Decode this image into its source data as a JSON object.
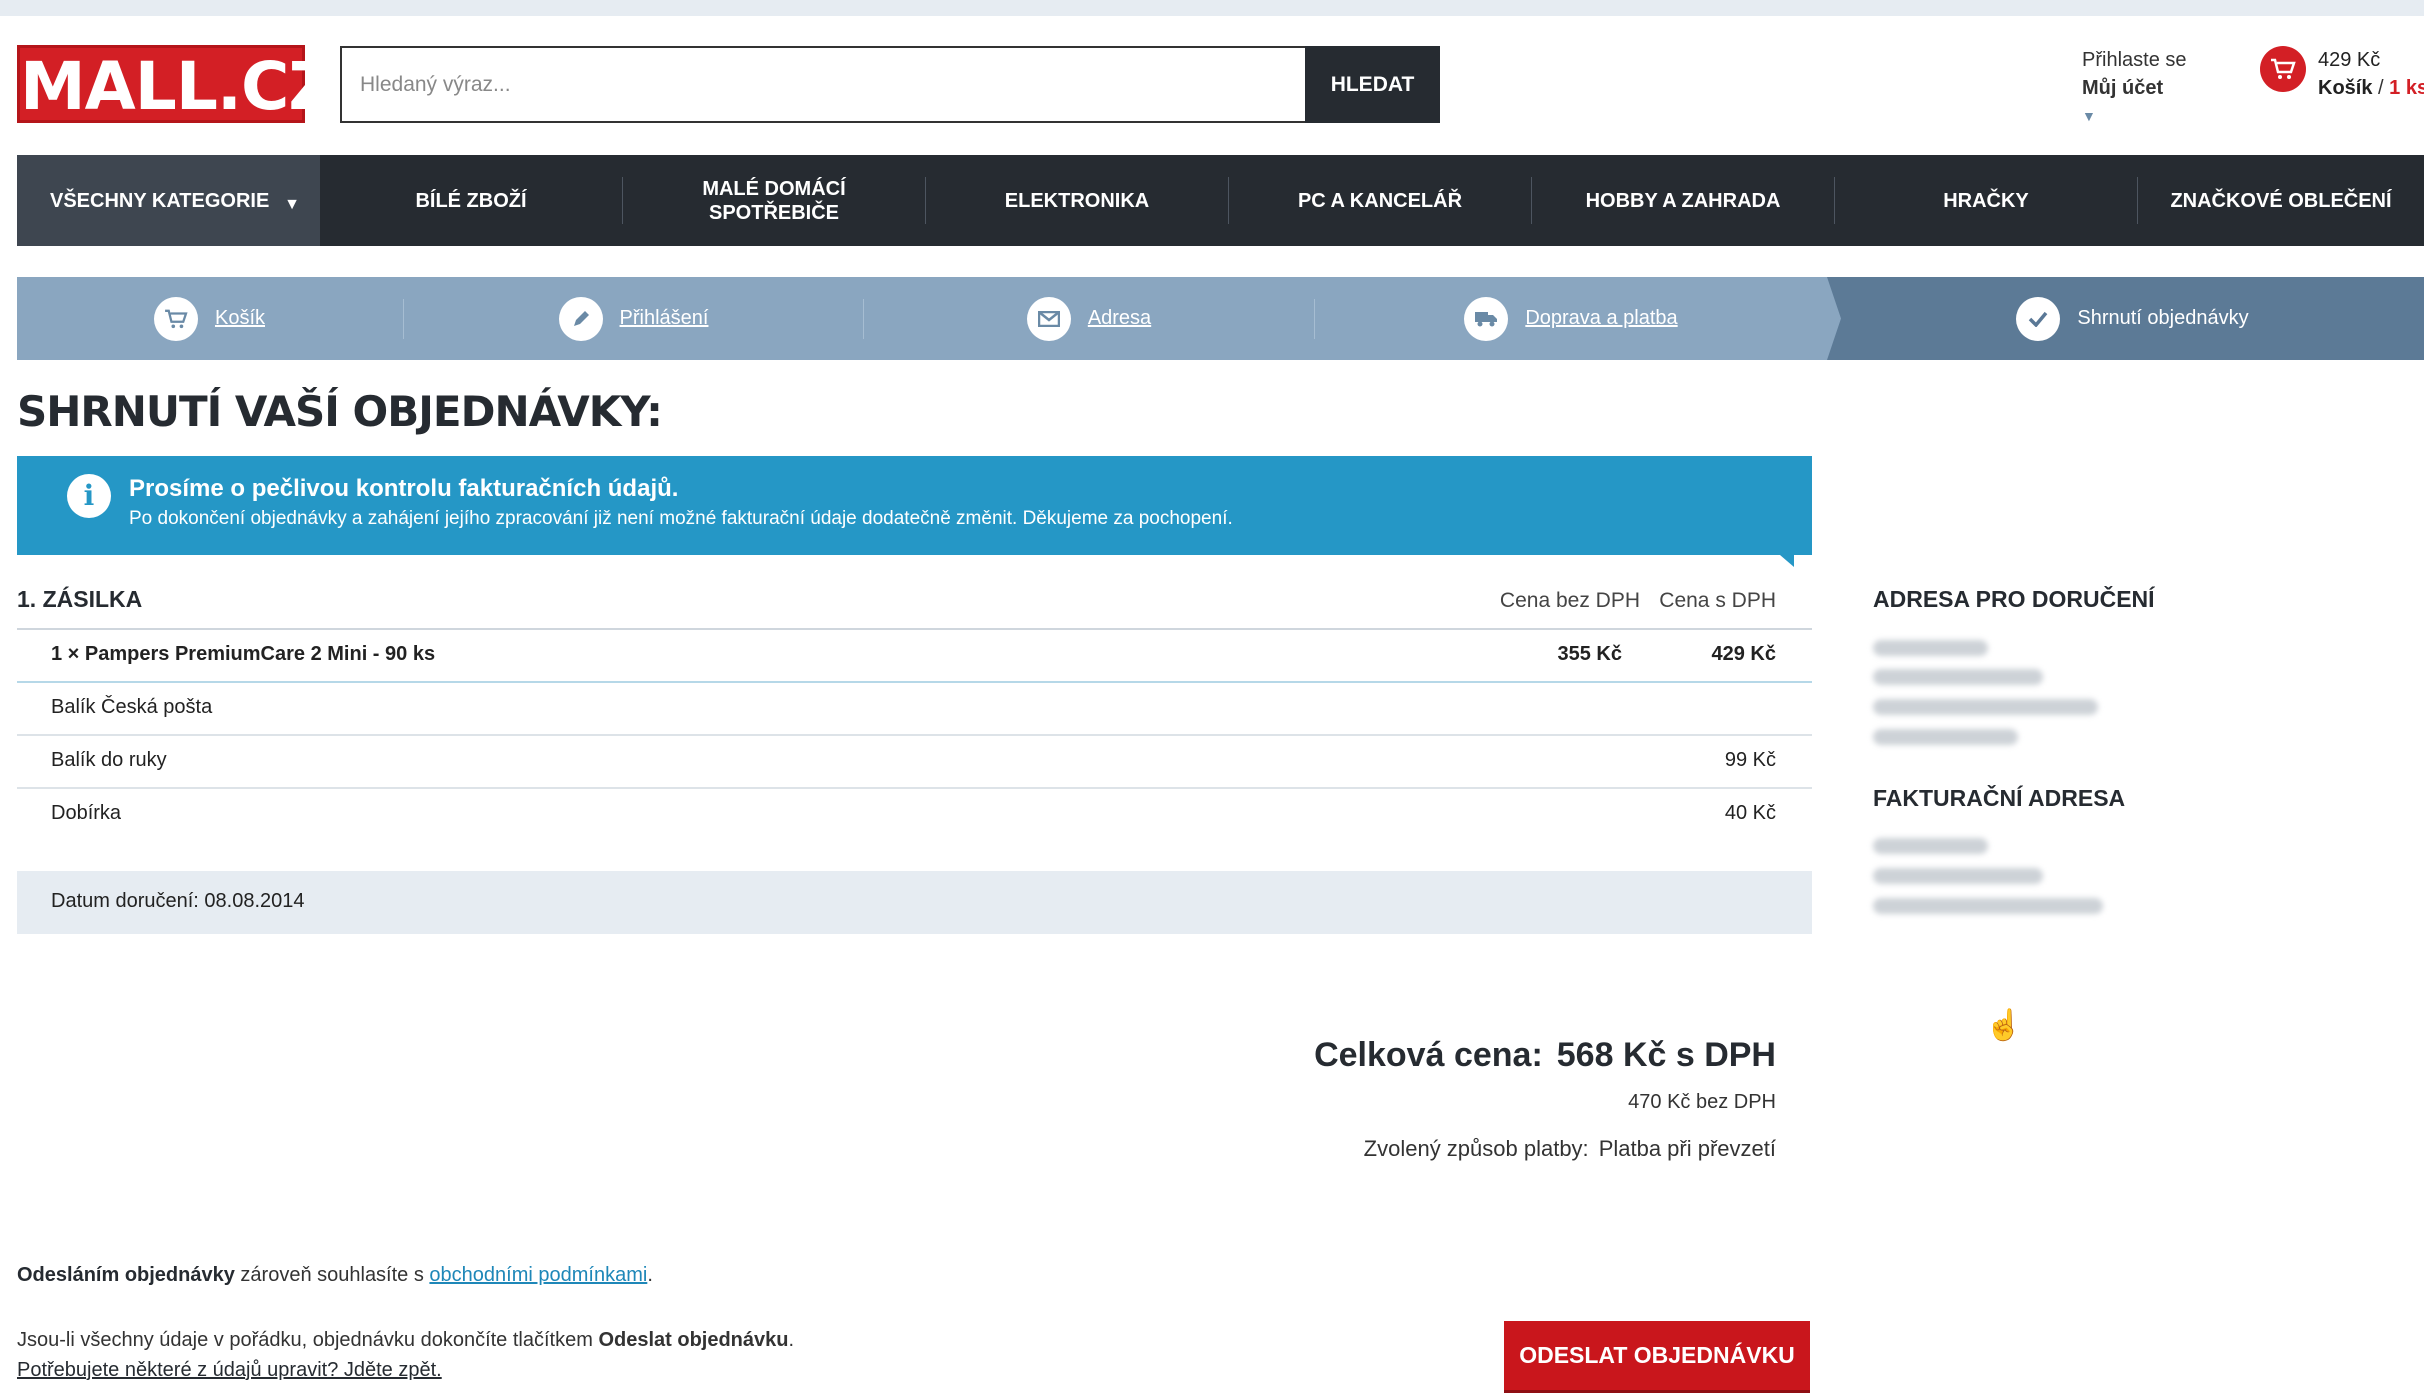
{
  "header": {
    "logo_text": "MALL.CZ",
    "search": {
      "placeholder": "Hledaný výraz...",
      "value": "",
      "button_label": "HLEDAT"
    },
    "account": {
      "line1": "Přihlaste se",
      "line2": "Můj účet",
      "chevron": "▼"
    },
    "cart": {
      "price": "429 Kč",
      "label": "Košík",
      "separator": " / ",
      "count": "1 ks"
    }
  },
  "nav": {
    "all_categories": "VŠECHNY KATEGORIE",
    "items": [
      "BÍLÉ ZBOŽÍ",
      "MALÉ DOMÁCÍ SPOTŘEBIČE",
      "ELEKTRONIKA",
      "PC A KANCELÁŘ",
      "HOBBY A ZAHRADA",
      "HRAČKY",
      "ZNAČKOVÉ OBLEČENÍ"
    ]
  },
  "steps": [
    {
      "label": "Košík",
      "icon": "cart-icon"
    },
    {
      "label": "Přihlášení",
      "icon": "pencil-icon"
    },
    {
      "label": "Adresa",
      "icon": "envelope-icon"
    },
    {
      "label": "Doprava a platba",
      "icon": "truck-icon"
    },
    {
      "label": "Shrnutí objednávky",
      "icon": "check-icon"
    }
  ],
  "page_title": "SHRNUTÍ VAŠÍ OBJEDNÁVKY:",
  "info": {
    "title": "Prosíme o pečlivou kontrolu fakturačních údajů.",
    "text": "Po dokončení objednávky a zahájení jejího zpracování již není možné fakturační údaje dodatečně změnit. Děkujeme za pochopení."
  },
  "shipment": {
    "title": "1. ZÁSILKA",
    "col_net": "Cena bez DPH",
    "col_gross": "Cena s DPH",
    "rows": [
      {
        "name": "1 × Pampers PremiumCare 2 Mini - 90 ks",
        "net": "355 Kč",
        "gross": "429 Kč"
      },
      {
        "name": "Balík Česká pošta",
        "net": "",
        "gross": ""
      },
      {
        "name": "Balík do ruky",
        "net": "",
        "gross": "99 Kč"
      },
      {
        "name": "Dobírka",
        "net": "",
        "gross": "40 Kč"
      }
    ],
    "delivery_date": "Datum doručení: 08.08.2014"
  },
  "sidebar": {
    "delivery_address_title": "ADRESA PRO DORUČENÍ",
    "billing_address_title": "FAKTURAČNÍ ADRESA"
  },
  "summary": {
    "total_label": "Celková cena:",
    "total_value": "568 Kč s DPH",
    "net_value": "470 Kč bez DPH",
    "payment_label": "Zvolený způsob platby:",
    "payment_value": "Platba při převzetí"
  },
  "footer": {
    "terms_bold": "Odesláním objednávky",
    "terms_text": " zároveň souhlasíte s ",
    "terms_link": "obchodními podmínkami",
    "terms_end": ".",
    "finish_text": "Jsou-li všechny údaje v pořádku, objednávku dokončíte tlačítkem ",
    "finish_bold": "Odeslat objednávku",
    "finish_end": ".",
    "back_link": "Potřebujete některé z údajů upravit? Jděte zpět.",
    "submit_label": "ODESLAT OBJEDNÁVKU"
  },
  "colors": {
    "brand": "#d31f25",
    "navbar": "#262b31",
    "steps": "#8aa6c0",
    "info": "#2597c6"
  }
}
